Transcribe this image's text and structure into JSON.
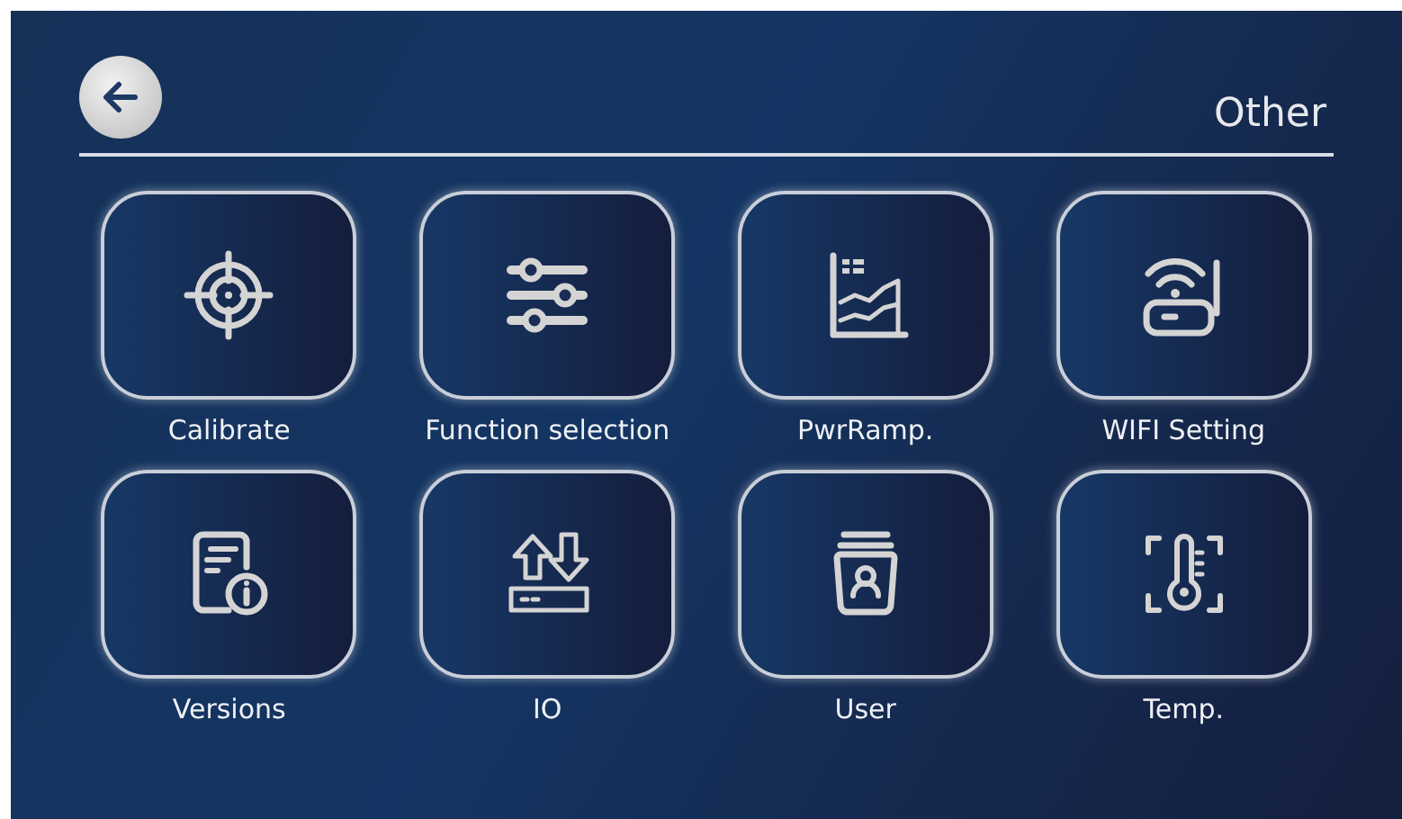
{
  "header": {
    "title": "Other"
  },
  "tiles": [
    {
      "label": "Calibrate",
      "kind": "target"
    },
    {
      "label": "Function selection",
      "kind": "sliders"
    },
    {
      "label": "PwrRamp.",
      "kind": "chart"
    },
    {
      "label": "WIFI Setting",
      "kind": "router"
    },
    {
      "label": "Versions",
      "kind": "docinfo"
    },
    {
      "label": "IO",
      "kind": "io"
    },
    {
      "label": "User",
      "kind": "user"
    },
    {
      "label": "Temp.",
      "kind": "thermo"
    }
  ]
}
